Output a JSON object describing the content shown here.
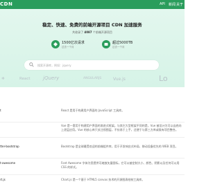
{
  "header": {
    "brand": "CDN",
    "nav": [
      "API",
      "新闻",
      "关于"
    ]
  },
  "hero": {
    "headline": "稳定、快速、免费的前端开源项目 CDN 加速服务",
    "subline_prefix": "共收录了",
    "subline_count": "4087",
    "subline_suffix": "个前端开源项目",
    "stats": [
      {
        "title": "1500亿次请求",
        "sub": "过去一个月"
      },
      {
        "title": "超过5000TB",
        "sub": "过去一个月"
      }
    ]
  },
  "search": {
    "placeholder": "搜索开源库，例如：jquery"
  },
  "logos": [
    "React",
    "jQuery",
    "ANGULARJS",
    "Vue.js",
    "Lo"
  ],
  "libraries": [
    {
      "name": "t",
      "desc": "React 是用于构建用户界面的 JavaScript 工具库。"
    },
    {
      "name": "",
      "desc": "Vue 是一套用于构建用户界面的渐进式框架。与其它大型框架不同的是，Vue 被设计为可以自底向上逐层应用。Vue 的核心库只关注视图层，不仅易于上手，还便于与第三方库或既有项目整合。"
    },
    {
      "name": "tter-bootstrap",
      "desc": "Bootstrap 是全球最受欢迎的前端组件库，用于开发响应式布局、移动设备优先的 WEB 项目。"
    },
    {
      "name": "t-awesome",
      "desc": "Font Awesome 字体为您提供可缩放矢量图标，它可以被定制大小、颜色、阴影以及任何可以用 CSS 的样式。"
    },
    {
      "name": "rt.js",
      "desc": "Chart.js 是一个基于 HTML5 canvas 技术的开源图表绘制工具库。"
    }
  ],
  "colors": {
    "brand": "#2a9d5c",
    "hero_bg": "#d6f3e7",
    "logo_gray": "#b9c2c8"
  }
}
